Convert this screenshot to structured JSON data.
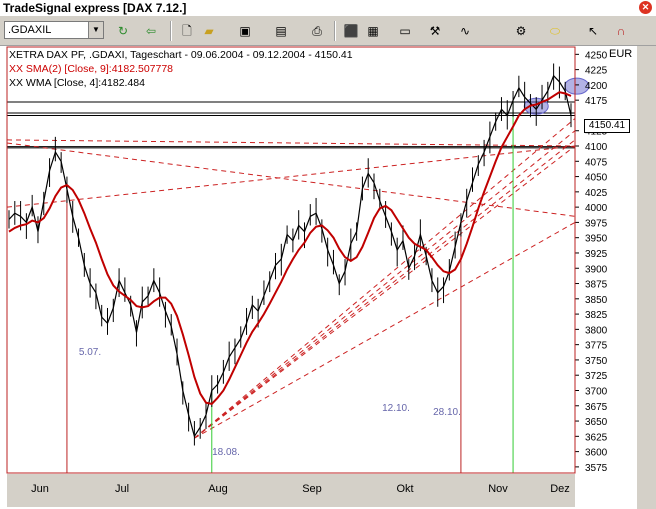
{
  "window": {
    "title": "TradeSignal express [DAX 7.12.]"
  },
  "toolbar": {
    "symbol": ".GDAXIL",
    "icons": [
      "refresh-icon",
      "back-icon",
      "new-icon",
      "open-icon",
      "save-icon",
      "print-setup-icon",
      "print-icon",
      "chart-icon",
      "indicator-icon",
      "chart-type-icon",
      "tools-icon",
      "properties-icon",
      "ellipse-icon",
      "pointer-icon",
      "magnet-icon"
    ]
  },
  "legend": {
    "line0": "XETRA DAX PF, .GDAXI, Tageschart - 09.06.2004 - 09.12.2004 - 4150.41",
    "line1": "XX SMA(2) [Close, 9]:4182.507778",
    "line2": "XX WMA [Close, 4]:4182.484"
  },
  "axis": {
    "currency": "EUR",
    "last_price": "4150.41",
    "price_ticks": [
      "4250",
      "4225",
      "4200",
      "4175",
      "4125",
      "4100",
      "4075",
      "4050",
      "4025",
      "4000",
      "3975",
      "3950",
      "3925",
      "3900",
      "3875",
      "3850",
      "3825",
      "3800",
      "3775",
      "3750",
      "3725",
      "3700",
      "3675",
      "3650",
      "3625",
      "3600",
      "3575"
    ],
    "months": [
      "Jun",
      "Jul",
      "Aug",
      "Sep",
      "Okt",
      "Nov",
      "Dez"
    ]
  },
  "annotations": [
    "5.07.",
    "18.08.",
    "12.10.",
    "28.10."
  ],
  "colors": {
    "price": "#000000",
    "sma": "#c00000",
    "trend": "#cc2222",
    "marker_green": "#33cc33",
    "marker_red": "#bb2222",
    "highlight": "#6666cc"
  },
  "chart_data": {
    "type": "line",
    "ylim": [
      3565,
      4262
    ],
    "series": [
      {
        "values": [
          3980,
          3990,
          3985,
          3975,
          4000,
          3960,
          4010,
          4060,
          4090,
          4075,
          4030,
          3985,
          3950,
          3905,
          3875,
          3860,
          3820,
          3810,
          3835,
          3880,
          3860,
          3840,
          3795,
          3845,
          3855,
          3880,
          3860,
          3830,
          3805,
          3760,
          3700,
          3660,
          3625,
          3640,
          3660,
          3700,
          3710,
          3730,
          3755,
          3770,
          3785,
          3810,
          3840,
          3830,
          3855,
          3880,
          3905,
          3915,
          3955,
          3945,
          3970,
          3960,
          3985,
          3990,
          3965,
          3930,
          3905,
          3875,
          3895,
          3940,
          3960,
          4030,
          4055,
          4040,
          4010,
          3985,
          3960,
          3930,
          3945,
          3900,
          3920,
          3955,
          3920,
          3880,
          3860,
          3870,
          3895,
          3935,
          3975,
          4010,
          4040,
          4070,
          4090,
          4115,
          4140,
          4160,
          4150,
          4175,
          4195,
          4180,
          4170,
          4160,
          4175,
          4190,
          4215,
          4205,
          4190,
          4150
        ]
      },
      {
        "values": [
          3960,
          3966,
          3970,
          3972,
          3978,
          3975,
          3982,
          3998,
          4018,
          4032,
          4036,
          4028,
          4012,
          3990,
          3965,
          3942,
          3915,
          3890,
          3872,
          3862,
          3855,
          3848,
          3838,
          3836,
          3838,
          3846,
          3852,
          3852,
          3842,
          3822,
          3792,
          3758,
          3722,
          3695,
          3680,
          3678,
          3688,
          3700,
          3718,
          3738,
          3758,
          3778,
          3796,
          3810,
          3825,
          3842,
          3860,
          3878,
          3898,
          3915,
          3930,
          3942,
          3958,
          3968,
          3970,
          3962,
          3950,
          3932,
          3918,
          3912,
          3918,
          3935,
          3958,
          3982,
          3998,
          4002,
          3995,
          3980,
          3965,
          3950,
          3940,
          3935,
          3930,
          3918,
          3905,
          3895,
          3892,
          3898,
          3915,
          3940,
          3968,
          3998,
          4025,
          4050,
          4075,
          4098,
          4115,
          4132,
          4150,
          4160,
          4166,
          4168,
          4172,
          4176,
          4182,
          4188,
          4186,
          4182
        ]
      }
    ]
  }
}
